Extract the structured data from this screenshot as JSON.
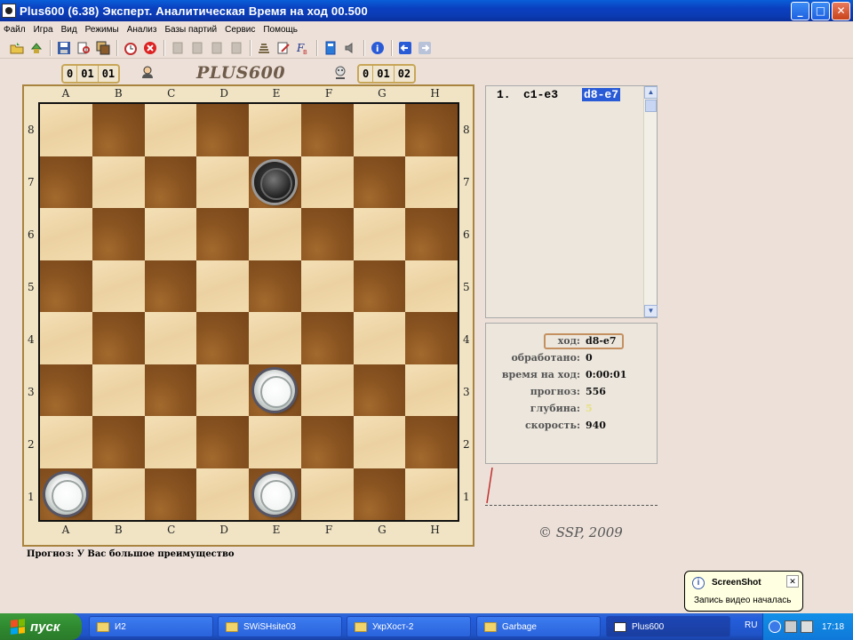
{
  "window": {
    "title": "Plus600 (6.38)  Эксперт.  Аналитическая   Время на ход 00.500",
    "minimize_glyph": "_",
    "maximize_glyph": "□",
    "close_glyph": "✕"
  },
  "menu": [
    "Файл",
    "Игра",
    "Вид",
    "Режимы",
    "Анализ",
    "Базы партий",
    "Сервис",
    "Помощь"
  ],
  "toolbar": {
    "icons": [
      "open-icon",
      "recycle-icon",
      "save-icon",
      "print-preview-icon",
      "copy-board-icon",
      "alarm-icon",
      "stop-icon",
      "rewind-disabled-icon",
      "back-disabled-icon",
      "forward-disabled-icon",
      "end-disabled-icon",
      "notes-icon",
      "edit-icon",
      "font-icon",
      "book-icon",
      "sound-icon",
      "info-icon",
      "back-arrow-icon",
      "forward-arrow-icon"
    ]
  },
  "score_left": [
    "0",
    "01",
    "01"
  ],
  "score_right": [
    "0",
    "01",
    "02"
  ],
  "logo": "PLUS600",
  "board": {
    "files": [
      "A",
      "B",
      "C",
      "D",
      "E",
      "F",
      "G",
      "H"
    ],
    "ranks": [
      "8",
      "7",
      "6",
      "5",
      "4",
      "3",
      "2",
      "1"
    ],
    "pieces": [
      {
        "square": "e7",
        "color": "black"
      },
      {
        "square": "e3",
        "color": "white"
      },
      {
        "square": "a1",
        "color": "white"
      },
      {
        "square": "e1",
        "color": "white"
      }
    ],
    "colors": {
      "light": "#f4dfb6",
      "dark": "#8a5421",
      "frame": "#f0e4c4"
    }
  },
  "forecast": "Прогноз: У Вас  большое преимущество",
  "moves": [
    {
      "num": "1.",
      "white": "c1-e3",
      "black": "d8-e7"
    }
  ],
  "info": {
    "move_label": "ход:",
    "move_value": "d8-e7",
    "processed_label": "обработано:",
    "processed_value": "0",
    "time_label": "время на ход:",
    "time_value": "0:00:01",
    "forecast_label": "прогноз:",
    "forecast_value": "556",
    "depth_label": "глубина:",
    "depth_value": "5",
    "speed_label": "скорость:",
    "speed_value": "940"
  },
  "copyright": "©  SSP, 2009",
  "balloon": {
    "title": "ScreenShot",
    "message": "Запись видео началась"
  },
  "taskbar": {
    "start": "пуск",
    "tasks": [
      "И2",
      "SWiSHsite03",
      "УкрХост-2",
      "Garbage",
      "Plus600"
    ],
    "lang": "RU",
    "clock": "17:18"
  }
}
